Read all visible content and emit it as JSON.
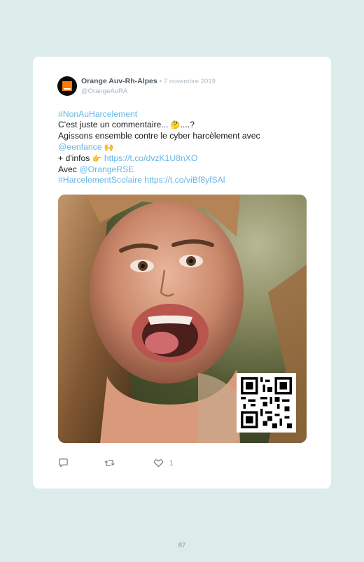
{
  "tweet": {
    "author_name": "Orange Auv-Rh-Alpes",
    "separator": "•",
    "date": "7 novembre 2019",
    "handle": "@OrangeAuRA",
    "text": {
      "line1_hashtag": "#NonAuHarcelement",
      "line2_text": "C'est juste un commentaire... ",
      "line2_emoji": "🤔",
      "line2_end": "....?",
      "line3_text": "Agissons ensemble contre le cyber harcèlement avec",
      "line4_mention": "@eenfance",
      "line4_emoji": "🙌",
      "line5_text": "+ d'infos ",
      "line5_emoji": "👉",
      "line5_link": "https://t.co/dvzK1U8nXO",
      "line6_text": "Avec ",
      "line6_mention": "@OrangeRSE",
      "line7_hashtag": "#HarcelementScolaire",
      "line7_link": "https://t.co/viBf8yfSAl"
    },
    "media": {
      "image_icon": "photo-of-girl",
      "qr_icon": "qr-code-icon"
    },
    "actions": {
      "reply_icon": "reply-icon",
      "retweet_icon": "retweet-icon",
      "like_icon": "heart-icon",
      "like_count": "1"
    }
  },
  "page": {
    "number": "87"
  },
  "colors": {
    "background": "#dbecea",
    "card": "#ffffff",
    "link": "#66b7e6",
    "brand_orange": "#ff7900"
  }
}
